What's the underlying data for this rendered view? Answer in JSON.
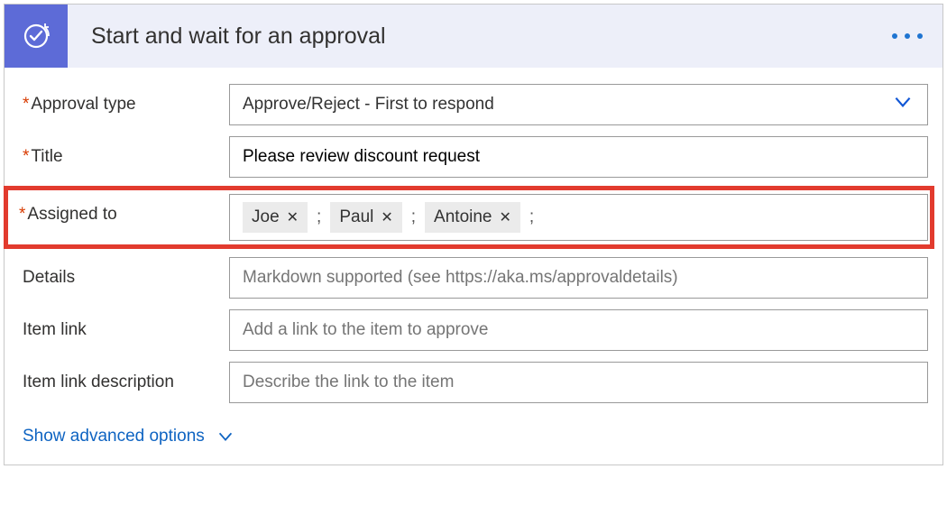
{
  "header": {
    "title": "Start and wait for an approval"
  },
  "fields": {
    "approval_type": {
      "label": "Approval type",
      "required": true,
      "value": "Approve/Reject - First to respond"
    },
    "title": {
      "label": "Title",
      "required": true,
      "value": "Please review discount request"
    },
    "assigned_to": {
      "label": "Assigned to",
      "required": true,
      "chips": [
        "Joe",
        "Paul",
        "Antoine"
      ]
    },
    "details": {
      "label": "Details",
      "required": false,
      "placeholder": "Markdown supported (see https://aka.ms/approvaldetails)"
    },
    "item_link": {
      "label": "Item link",
      "required": false,
      "placeholder": "Add a link to the item to approve"
    },
    "item_link_desc": {
      "label": "Item link description",
      "required": false,
      "placeholder": "Describe the link to the item"
    }
  },
  "footer": {
    "show_advanced": "Show advanced options"
  },
  "symbols": {
    "asterisk": "*",
    "separator": ";"
  }
}
